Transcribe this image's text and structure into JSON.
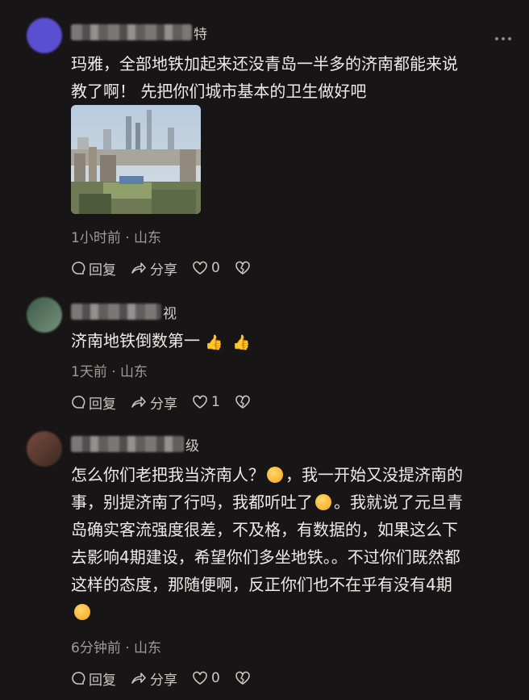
{
  "comments": [
    {
      "username_visible": "特",
      "text": "玛雅，全部地铁加起来还没青岛一半多的济南都能来说教了啊！ 先把你们城市基本的卫生做好吧",
      "line1": "玛雅，全部地铁加起来还没青岛一半多的济南都能来说",
      "line2": "教了啊！ 先把你们城市基本的卫生做好吧",
      "time": "1小时前 · 山东",
      "reply_label": "回复",
      "share_label": "分享",
      "like_count": "0",
      "avatar_color": "#5a4fd0"
    },
    {
      "username_visible": "视",
      "text": "济南地铁倒数第一",
      "time": "1天前 · 山东",
      "reply_label": "回复",
      "share_label": "分享",
      "like_count": "1",
      "avatar_color": "#4b6b5a"
    },
    {
      "username_visible": "级",
      "lines": [
        "怎么你们老把我当济南人？",
        "，我一开始又没提济南的",
        "事，别提济南了行吗，我都听吐了",
        "。我就说了元旦青",
        "岛确实客流强度很差，不及格，有数据的，如果这么下",
        "去影响4期建设，希望你们多坐地铁。。不过你们既然都",
        "这样的态度，那随便啊，反正你们也不在乎有没有4期"
      ],
      "time": "6分钟前 · 山东",
      "reply_label": "回复",
      "share_label": "分享",
      "like_count": "0",
      "avatar_color": "#6b4a40"
    }
  ]
}
